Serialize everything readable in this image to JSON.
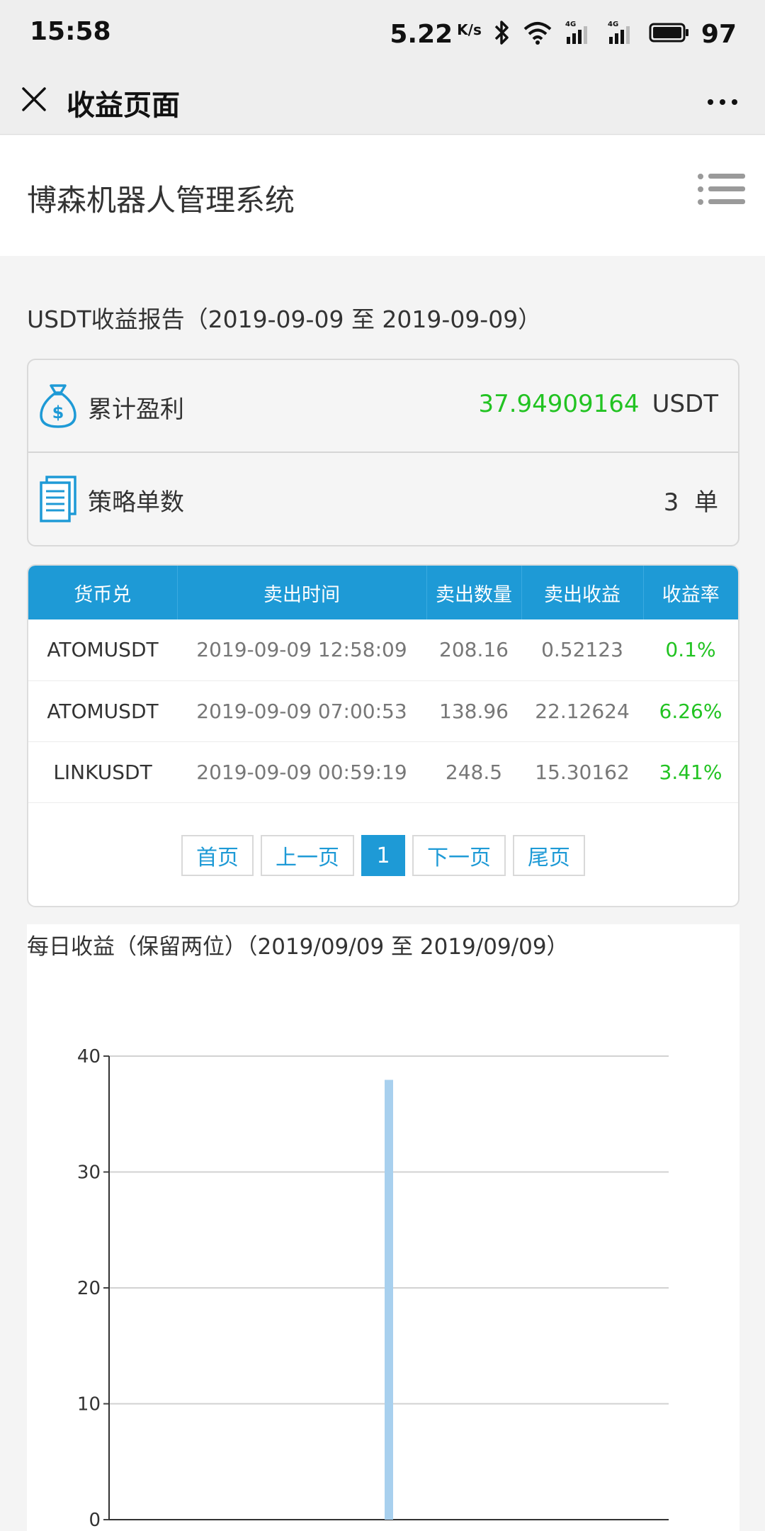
{
  "status_bar": {
    "time": "15:58",
    "net_speed": "5.22",
    "net_speed_unit": "K/s",
    "signal_labels": [
      "4G",
      "4G"
    ],
    "battery": "97"
  },
  "title_bar": {
    "title": "收益页面"
  },
  "site": {
    "name": "博森机器人管理系统"
  },
  "report": {
    "title": "USDT收益报告（2019-09-09 至 2019-09-09）"
  },
  "summary": {
    "profit_label": "累计盈利",
    "profit_value": "37.94909164",
    "profit_unit": "USDT",
    "orders_label": "策略单数",
    "orders_value": "3  单"
  },
  "table": {
    "headers": [
      "货币兑",
      "卖出时间",
      "卖出数量",
      "卖出收益",
      "收益率"
    ],
    "rows": [
      [
        "ATOMUSDT",
        "2019-09-09 12:58:09",
        "208.16",
        "0.52123",
        "0.1%"
      ],
      [
        "ATOMUSDT",
        "2019-09-09 07:00:53",
        "138.96",
        "22.12624",
        "6.26%"
      ],
      [
        "LINKUSDT",
        "2019-09-09 00:59:19",
        "248.5",
        "15.30162",
        "3.41%"
      ]
    ]
  },
  "pager": {
    "first": "首页",
    "prev": "上一页",
    "current": "1",
    "next": "下一页",
    "last": "尾页"
  },
  "colors": {
    "accent": "#1e9ad6",
    "positive": "#22c322",
    "bar": "#a8d0ee"
  },
  "chart_data": {
    "type": "bar",
    "title": "每日收益（保留两位）（2019/09/09 至 2019/09/09）",
    "categories": [
      ""
    ],
    "values": [
      37.95
    ],
    "ylim": [
      0,
      40
    ],
    "yticks": [
      0,
      10,
      20,
      30,
      40
    ],
    "grid": true
  }
}
